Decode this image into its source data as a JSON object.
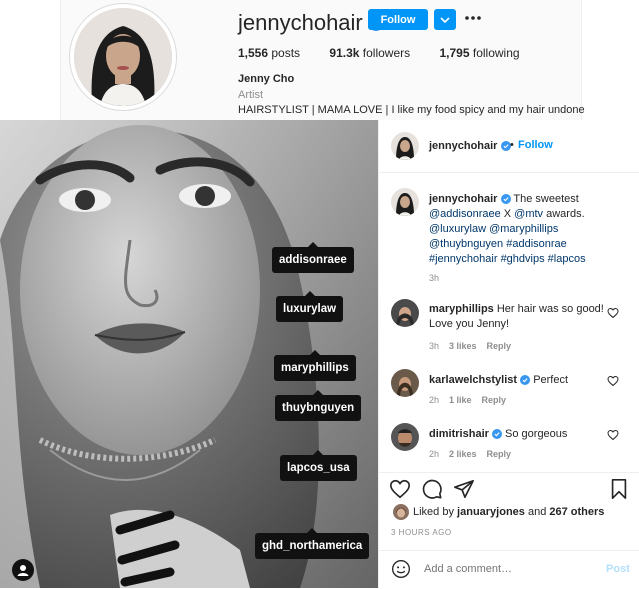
{
  "profile": {
    "username": "jennychohair",
    "follow_label": "Follow",
    "stats": {
      "posts": "1,556",
      "posts_label": "posts",
      "followers": "91.3k",
      "followers_label": "followers",
      "following": "1,795",
      "following_label": "following"
    },
    "full_name": "Jenny Cho",
    "category": "Artist",
    "bio": "HAIRSTYLIST | MAMA LOVE | I like my food spicy and my hair undone"
  },
  "photo_tags": [
    "addisonraee",
    "luxurylaw",
    "maryphillips",
    "thuybnguyen",
    "lapcos_usa",
    "ghd_northamerica"
  ],
  "post_header": {
    "username": "jennychohair",
    "dot": "•",
    "follow_label": "Follow"
  },
  "caption": {
    "username": "jennychohair",
    "text_a": "The sweetest",
    "m1": "@addisonraee",
    "x": " X ",
    "m2": "@mtv",
    "awards": " awards.",
    "m3": "@luxurylaw",
    "m4": "@maryphillips",
    "m5": "@thuybnguyen",
    "h1": "#addisonrae",
    "h2": "#jennychohair",
    "h3": "#ghdvips",
    "h4": "#lapcos",
    "time": "3h"
  },
  "comments": [
    {
      "username": "maryphillips",
      "text": "Her hair was so good! Love you Jenny!",
      "time": "3h",
      "likes": "3 likes",
      "reply": "Reply"
    },
    {
      "username": "karlawelchstylist",
      "text": "Perfect",
      "time": "2h",
      "likes": "1 like",
      "reply": "Reply"
    },
    {
      "username": "dimitrishair",
      "text": "So gorgeous",
      "time": "2h",
      "likes": "2 likes",
      "reply": "Reply"
    }
  ],
  "likes": {
    "prefix": "Liked by",
    "user": "januaryjones",
    "and": "and",
    "count": "267 others"
  },
  "time_ago": "3 HOURS AGO",
  "add_comment": {
    "placeholder": "Add a comment…",
    "post_label": "Post"
  },
  "colors": {
    "accent": "#0095f6",
    "verified": "#3897f0",
    "mention": "#00376b"
  }
}
